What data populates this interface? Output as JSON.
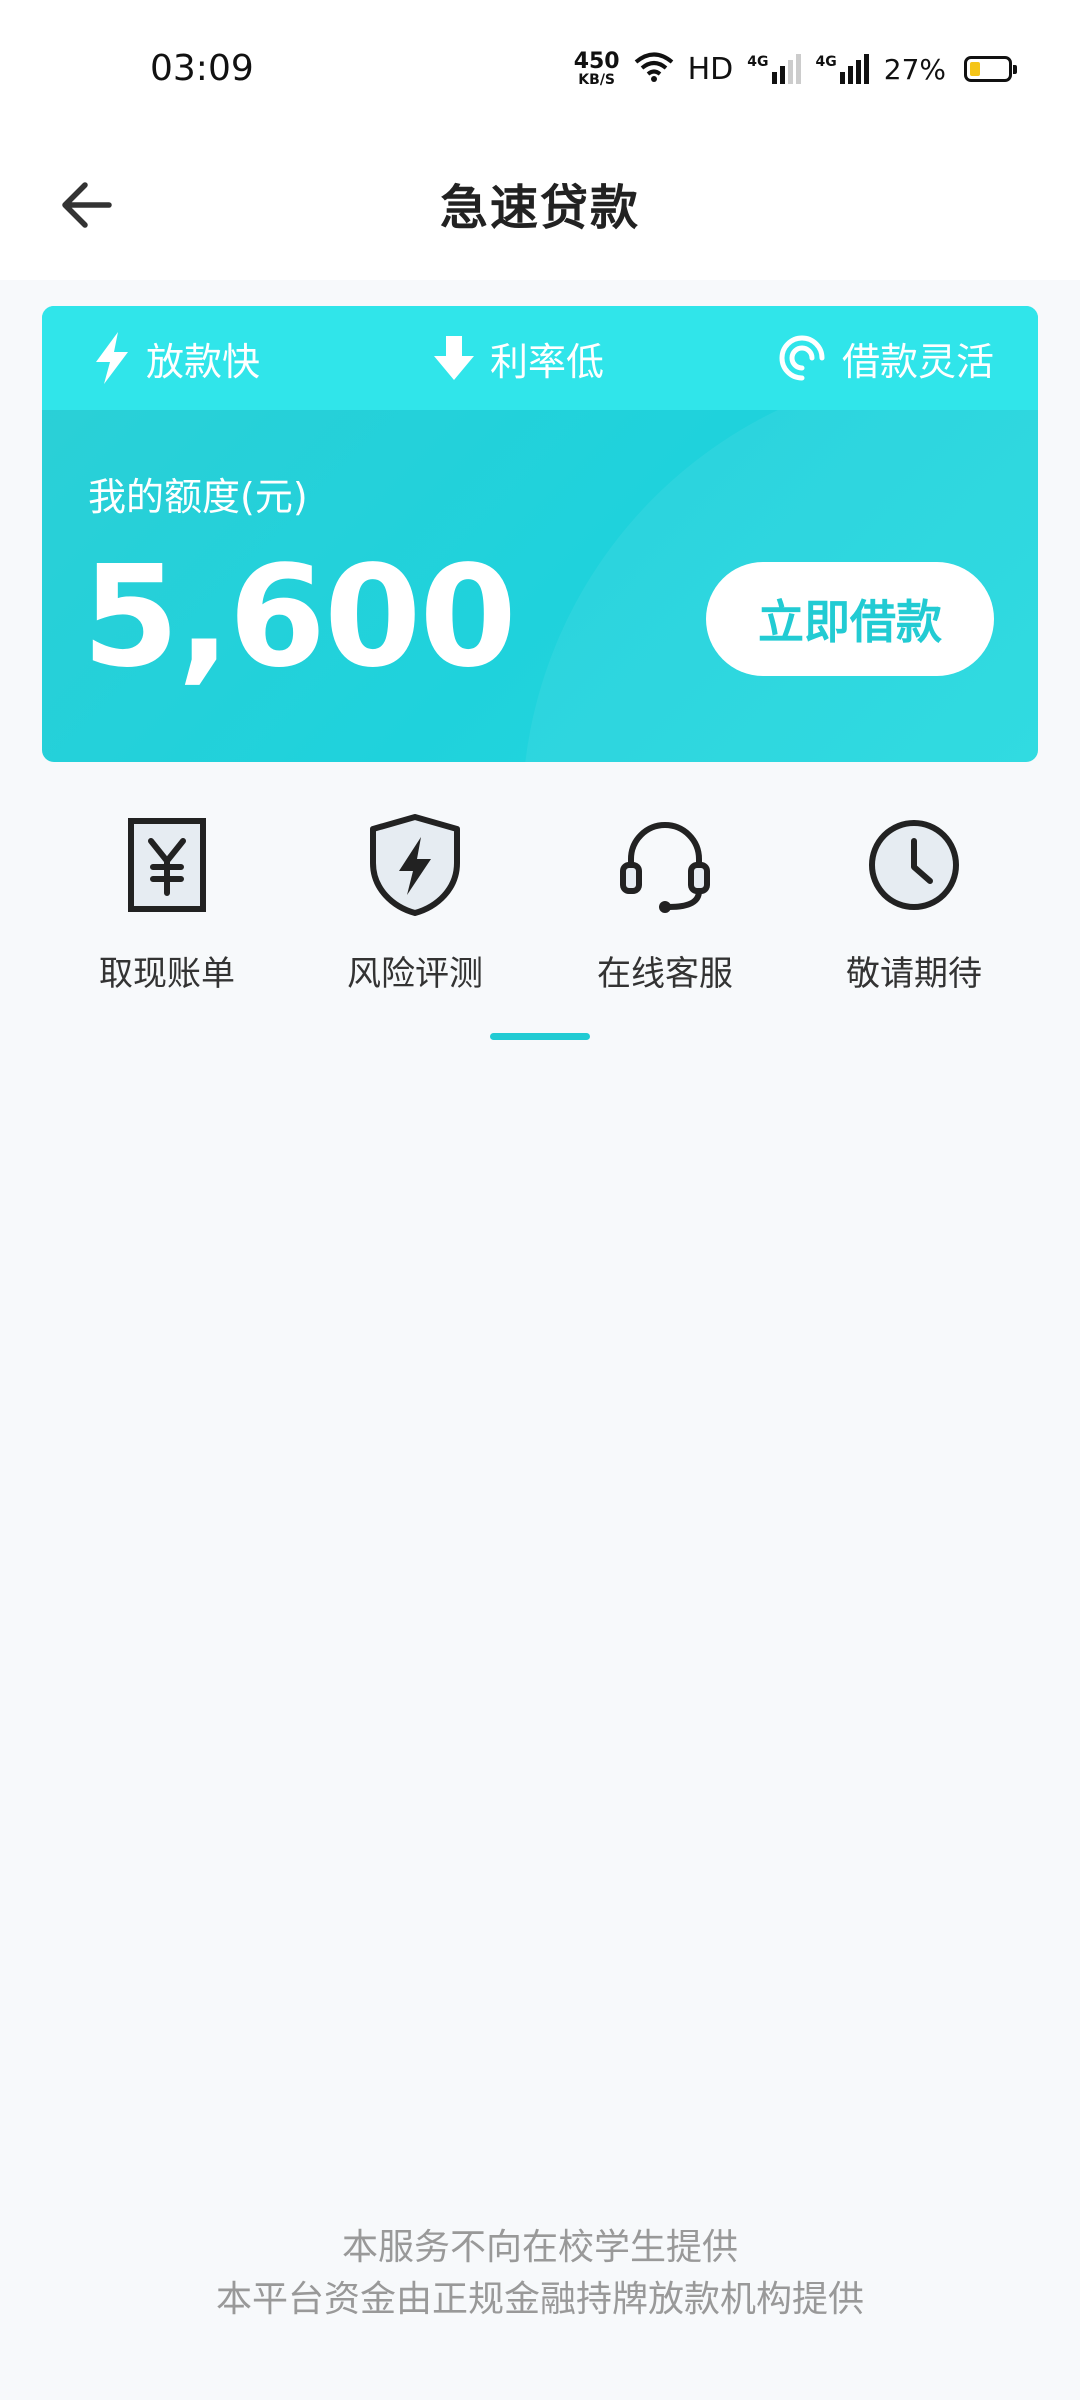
{
  "status": {
    "time": "03:09",
    "net_speed_value": "450",
    "net_speed_unit": "KB/S",
    "hd_label": "HD",
    "signal1": "4G",
    "signal2": "4G",
    "battery": "27%",
    "battery_level": 0.27
  },
  "header": {
    "title": "急速贷款"
  },
  "card": {
    "features": [
      {
        "label": "放款快",
        "icon": "bolt-icon"
      },
      {
        "label": "利率低",
        "icon": "arrow-down-icon"
      },
      {
        "label": "借款灵活",
        "icon": "swirl-icon"
      }
    ],
    "quota_label": "我的额度(元)",
    "quota_value": "5,600",
    "borrow_button": "立即借款"
  },
  "tools": [
    {
      "label": "取现账单",
      "icon": "bill-icon"
    },
    {
      "label": "风险评测",
      "icon": "shield-icon"
    },
    {
      "label": "在线客服",
      "icon": "headset-icon"
    },
    {
      "label": "敬请期待",
      "icon": "clock-icon"
    }
  ],
  "footer": {
    "line1": "本服务不向在校学生提供",
    "line2": "本平台资金由正规金融持牌放款机构提供"
  },
  "colors": {
    "accent": "#22cbd3",
    "card_top": "#30e5ea",
    "background": "#f7f9fb"
  }
}
